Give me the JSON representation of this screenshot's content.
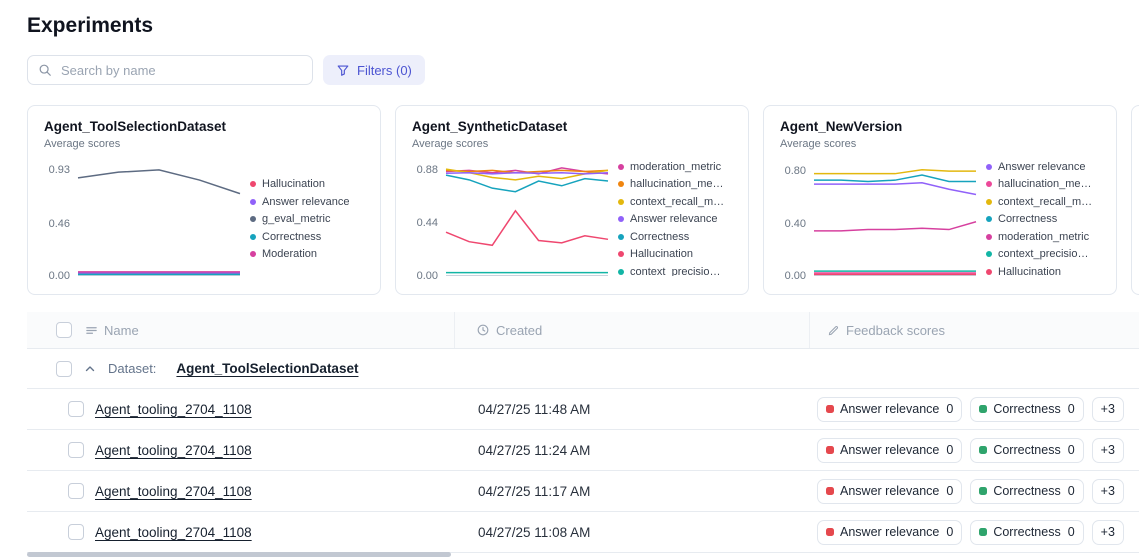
{
  "page": {
    "title": "Experiments"
  },
  "toolbar": {
    "search_placeholder": "Search by name",
    "filters_label": "Filters (0)"
  },
  "colors": {
    "accent": "#4c54d2",
    "accent_bg": "#edeffb"
  },
  "chart_data": [
    {
      "type": "line",
      "title": "Agent_ToolSelectionDataset",
      "subtitle": "Average scores",
      "y_ticks": [
        0.93,
        0.46,
        0
      ],
      "ymax": 1.0,
      "legend_position": "right",
      "series": [
        {
          "name": "Hallucination",
          "color": "#ef476f",
          "values": [
            0.012,
            0.012,
            0.012,
            0.012,
            0.012
          ]
        },
        {
          "name": "Answer relevance",
          "color": "#9061f9",
          "values": [
            0.02,
            0.02,
            0.02,
            0.02,
            0.02
          ]
        },
        {
          "name": "g_eval_metric",
          "color": "#5d6b82",
          "values": [
            0.86,
            0.91,
            0.93,
            0.84,
            0.72
          ]
        },
        {
          "name": "Correctness",
          "color": "#16a3bd",
          "values": [
            0.005,
            0.005,
            0.005,
            0.005,
            0.005
          ]
        },
        {
          "name": "Moderation",
          "color": "#d6409f",
          "values": [
            0.028,
            0.028,
            0.028,
            0.028,
            0.028
          ]
        }
      ]
    },
    {
      "type": "line",
      "title": "Agent_SyntheticDataset",
      "subtitle": "Average scores",
      "y_ticks": [
        0.88,
        0.44,
        0
      ],
      "ymax": 0.95,
      "legend_position": "right",
      "series": [
        {
          "name": "moderation_metric",
          "color": "#d6409f",
          "values": [
            0.87,
            0.88,
            0.86,
            0.88,
            0.85,
            0.9,
            0.87,
            0.85
          ]
        },
        {
          "name": "hallucination_me…",
          "color": "#f0850f",
          "values": [
            0.88,
            0.87,
            0.88,
            0.86,
            0.87,
            0.88,
            0.87,
            0.88
          ]
        },
        {
          "name": "context_recall_m…",
          "color": "#e3b80e",
          "values": [
            0.89,
            0.86,
            0.82,
            0.8,
            0.83,
            0.81,
            0.85,
            0.88
          ]
        },
        {
          "name": "Answer relevance",
          "color": "#9061f9",
          "values": [
            0.855,
            0.86,
            0.85,
            0.86,
            0.855,
            0.86,
            0.85,
            0.86
          ]
        },
        {
          "name": "Correctness",
          "color": "#16a3bd",
          "values": [
            0.84,
            0.8,
            0.73,
            0.7,
            0.79,
            0.75,
            0.81,
            0.79
          ]
        },
        {
          "name": "Hallucination",
          "color": "#ef476f",
          "values": [
            0.36,
            0.28,
            0.25,
            0.54,
            0.29,
            0.27,
            0.33,
            0.3
          ]
        },
        {
          "name": "context_precisio…",
          "color": "#12b5a5",
          "values": [
            0.02,
            0.02,
            0.02,
            0.02,
            0.02,
            0.02,
            0.02,
            0.02
          ]
        }
      ]
    },
    {
      "type": "line",
      "title": "Agent_NewVersion",
      "subtitle": "Average scores",
      "y_ticks": [
        0.8,
        0.4,
        0
      ],
      "ymax": 0.87,
      "legend_position": "right",
      "series": [
        {
          "name": "Answer relevance",
          "color": "#9061f9",
          "values": [
            0.7,
            0.7,
            0.7,
            0.7,
            0.71,
            0.66,
            0.62
          ]
        },
        {
          "name": "hallucination_me…",
          "color": "#ec4899",
          "values": [
            0.015,
            0.015,
            0.015,
            0.015,
            0.015,
            0.015,
            0.015
          ]
        },
        {
          "name": "context_recall_m…",
          "color": "#e3b80e",
          "values": [
            0.78,
            0.78,
            0.78,
            0.78,
            0.81,
            0.8,
            0.8
          ]
        },
        {
          "name": "Correctness",
          "color": "#16a3bd",
          "values": [
            0.73,
            0.73,
            0.72,
            0.73,
            0.77,
            0.72,
            0.72
          ]
        },
        {
          "name": "moderation_metric",
          "color": "#d6409f",
          "values": [
            0.34,
            0.34,
            0.35,
            0.35,
            0.36,
            0.35,
            0.41
          ]
        },
        {
          "name": "context_precisio…",
          "color": "#12b5a5",
          "values": [
            0.03,
            0.03,
            0.03,
            0.03,
            0.03,
            0.03,
            0.03
          ]
        },
        {
          "name": "Hallucination",
          "color": "#ef476f",
          "values": [
            0.005,
            0.005,
            0.005,
            0.005,
            0.005,
            0.005,
            0.005
          ]
        }
      ]
    }
  ],
  "table": {
    "columns": [
      {
        "label": "Name",
        "icon": "text-rows-icon"
      },
      {
        "label": "Created",
        "icon": "clock-icon"
      },
      {
        "label": "Feedback scores",
        "icon": "pencil-icon"
      }
    ],
    "group": {
      "prefix": "Dataset:",
      "name": "Agent_ToolSelectionDataset"
    },
    "rows": [
      {
        "name": "Agent_tooling_2704_1108",
        "created": "04/27/25 11:48 AM"
      },
      {
        "name": "Agent_tooling_2704_1108",
        "created": "04/27/25 11:24 AM"
      },
      {
        "name": "Agent_tooling_2704_1108",
        "created": "04/27/25 11:17 AM"
      },
      {
        "name": "Agent_tooling_2704_1108",
        "created": "04/27/25 11:08 AM"
      }
    ],
    "row_badges": [
      {
        "label": "Answer relevance",
        "value": "0",
        "color": "#e5484d"
      },
      {
        "label": "Correctness",
        "value": "0",
        "color": "#2fa46c"
      }
    ],
    "overflow_badge": "+3"
  }
}
